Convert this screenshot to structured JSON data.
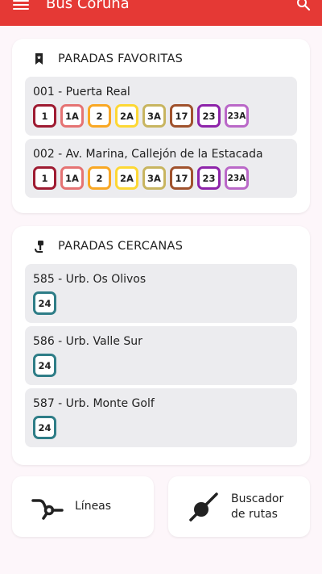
{
  "appbar": {
    "title": "Bus Coruña"
  },
  "favorites": {
    "title": "PARADAS FAVORITAS",
    "stops": [
      {
        "name": "001 - Puerta Real",
        "lines": [
          {
            "label": "1",
            "color": "#9e1b32"
          },
          {
            "label": "1A",
            "color": "#e57373"
          },
          {
            "label": "2",
            "color": "#f9a825"
          },
          {
            "label": "2A",
            "color": "#fdd835"
          },
          {
            "label": "3A",
            "color": "#c8b560"
          },
          {
            "label": "17",
            "color": "#a0522d"
          },
          {
            "label": "23",
            "color": "#8e24aa"
          },
          {
            "label": "23A",
            "color": "#ba68c8"
          }
        ]
      },
      {
        "name": "002 - Av. Marina, Callejón de la Estacada",
        "lines": [
          {
            "label": "1",
            "color": "#9e1b32"
          },
          {
            "label": "1A",
            "color": "#e57373"
          },
          {
            "label": "2",
            "color": "#f9a825"
          },
          {
            "label": "2A",
            "color": "#fdd835"
          },
          {
            "label": "3A",
            "color": "#c8b560"
          },
          {
            "label": "17",
            "color": "#a0522d"
          },
          {
            "label": "23",
            "color": "#8e24aa"
          },
          {
            "label": "23A",
            "color": "#ba68c8"
          }
        ]
      }
    ]
  },
  "nearby": {
    "title": "PARADAS CERCANAS",
    "stops": [
      {
        "name": "585 - Urb. Os Olivos",
        "lines": [
          {
            "label": "24",
            "color": "#2e7d87"
          }
        ]
      },
      {
        "name": "586 - Urb. Valle Sur",
        "lines": [
          {
            "label": "24",
            "color": "#2e7d87"
          }
        ]
      },
      {
        "name": "587 - Urb. Monte Golf",
        "lines": [
          {
            "label": "24",
            "color": "#2e7d87"
          }
        ]
      }
    ]
  },
  "actions": {
    "lines_label": "Líneas",
    "route_finder_line1": "Buscador",
    "route_finder_line2": "de rutas"
  },
  "colors": {
    "appbar": "#e53935",
    "background": "#fdf6fa",
    "stop_bg": "#ececef"
  },
  "icons": {
    "menu": "menu-icon",
    "search": "search-icon",
    "favorites": "bookmark-icon",
    "nearby": "bus-stop-icon",
    "lines": "route-lines-icon",
    "route_finder": "route-finder-icon"
  }
}
